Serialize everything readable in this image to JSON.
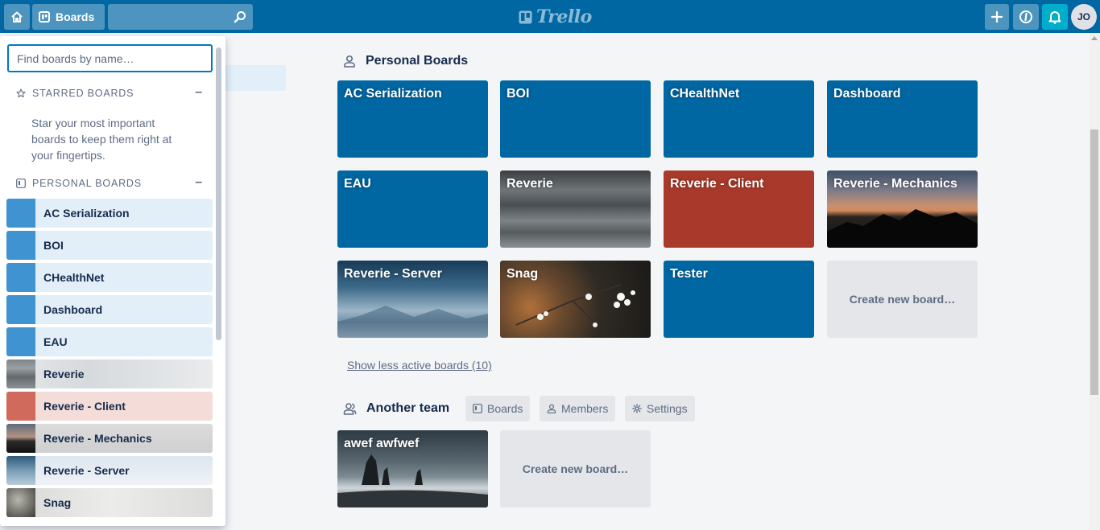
{
  "header": {
    "boards_label": "Boards",
    "logo_text": "Trello",
    "avatar_initials": "JO",
    "colors": {
      "bar": "#0067a3",
      "bell": "#00aecc"
    }
  },
  "drawer": {
    "search_placeholder": "Find boards by name…",
    "starred_heading": "STARRED BOARDS",
    "starred_hint": "Star your most important boards to keep them right at your fingertips.",
    "personal_heading": "PERSONAL BOARDS",
    "items": [
      {
        "label": "AC Serialization"
      },
      {
        "label": "BOI"
      },
      {
        "label": "CHealthNet"
      },
      {
        "label": "Dashboard"
      },
      {
        "label": "EAU"
      },
      {
        "label": "Reverie"
      },
      {
        "label": "Reverie - Client"
      },
      {
        "label": "Reverie - Mechanics"
      },
      {
        "label": "Reverie - Server"
      },
      {
        "label": "Snag"
      }
    ]
  },
  "personal": {
    "title": "Personal Boards",
    "boards": [
      {
        "title": "AC Serialization",
        "bg": "blue"
      },
      {
        "title": "BOI",
        "bg": "blue"
      },
      {
        "title": "CHealthNet",
        "bg": "blue"
      },
      {
        "title": "Dashboard",
        "bg": "blue"
      },
      {
        "title": "EAU",
        "bg": "blue"
      },
      {
        "title": "Reverie",
        "bg": "photo-water"
      },
      {
        "title": "Reverie - Client",
        "bg": "red"
      },
      {
        "title": "Reverie - Mechanics",
        "bg": "photo-mountain-sunset"
      },
      {
        "title": "Reverie - Server",
        "bg": "photo-misty-mountains"
      },
      {
        "title": "Snag",
        "bg": "photo-blossoms"
      },
      {
        "title": "Tester",
        "bg": "blue"
      }
    ],
    "create_label": "Create new board…",
    "show_less": "Show less active boards (10)"
  },
  "team": {
    "title": "Another team",
    "tabs": {
      "boards": "Boards",
      "members": "Members",
      "settings": "Settings"
    },
    "boards": [
      {
        "title": "awef awfwef",
        "bg": "photo-sea-stacks"
      }
    ],
    "create_label": "Create new board…"
  }
}
